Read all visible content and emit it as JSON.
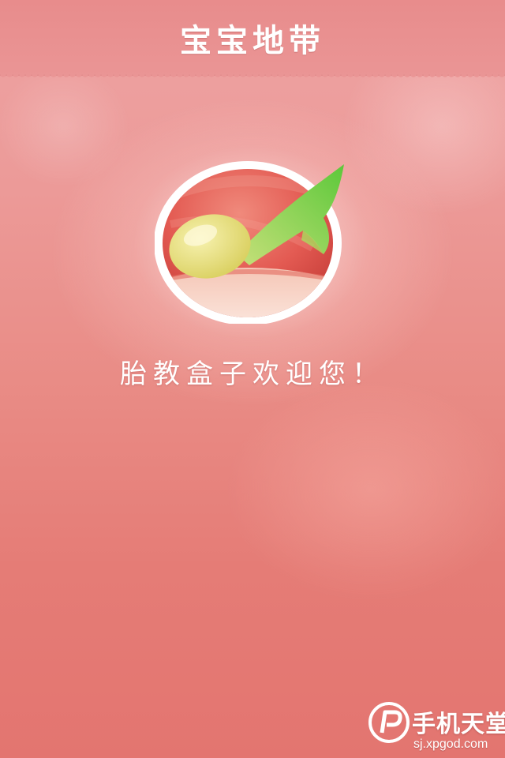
{
  "header": {
    "title": "宝宝地带"
  },
  "logo": {
    "icon": "music-note-icon"
  },
  "welcome_text": "胎教盒子欢迎您！",
  "watermark": {
    "title": "手机天堂",
    "url": "sj.xpgod.com"
  },
  "colors": {
    "background": "#e98c86",
    "header": "#e88c8c",
    "note_green": "#8fd14f",
    "note_head": "#e9e38a",
    "logo_red": "#e4584f"
  }
}
